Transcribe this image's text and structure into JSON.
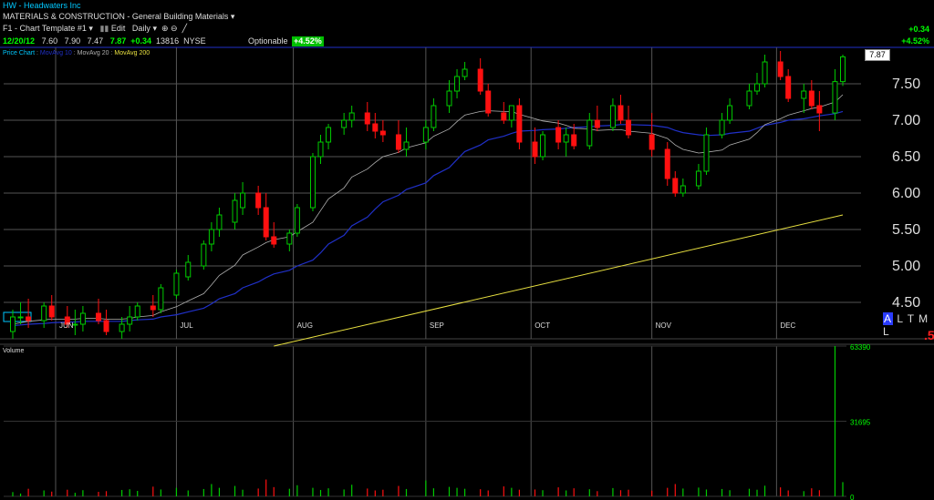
{
  "header": {
    "symbol": "HW",
    "company": "Headwaters Inc",
    "sector": "MATERIALS & CONSTRUCTION - General Building Materials",
    "template": "F1 - Chart Template #1",
    "edit_label": "Edit",
    "period_label": "Daily",
    "quote": {
      "date": "12/20/12",
      "open": "7.60",
      "high": "7.90",
      "low": "7.47",
      "last": "7.87",
      "change": "+0.34",
      "volume": "13816",
      "exchange": "NYSE"
    },
    "optionable_label": "Optionable",
    "change_pct": "+4.52%",
    "right_change": "+0.34",
    "right_change_pct": "+4.52%"
  },
  "legend": {
    "price_chart": "Price Chart",
    "ma10": "MovAvg 10",
    "ma20": "MovAvg 20",
    "ma200": "MovAvg 200"
  },
  "volume_label": "Volume",
  "altml": {
    "a": "A",
    "rest": "L T M L"
  },
  "footer_mark": ".5",
  "colors": {
    "up": "#00cc00",
    "down": "#ff1010",
    "ma20": "#b0b0b0",
    "ma10": "#2030c8",
    "ma200": "#e8e040",
    "grid": "#555555",
    "text": "#dddddd"
  },
  "chart_data": {
    "type": "candlestick",
    "x": [
      "2012-05-21",
      "2012-05-23",
      "2012-05-25",
      "2012-05-29",
      "2012-05-31",
      "2012-06-04",
      "2012-06-06",
      "2012-06-08",
      "2012-06-12",
      "2012-06-14",
      "2012-06-18",
      "2012-06-20",
      "2012-06-22",
      "2012-06-26",
      "2012-06-28",
      "2012-07-02",
      "2012-07-05",
      "2012-07-09",
      "2012-07-11",
      "2012-07-13",
      "2012-07-17",
      "2012-07-19",
      "2012-07-23",
      "2012-07-25",
      "2012-07-27",
      "2012-07-31",
      "2012-08-02",
      "2012-08-06",
      "2012-08-08",
      "2012-08-10",
      "2012-08-14",
      "2012-08-16",
      "2012-08-20",
      "2012-08-22",
      "2012-08-24",
      "2012-08-28",
      "2012-08-30",
      "2012-09-04",
      "2012-09-06",
      "2012-09-10",
      "2012-09-12",
      "2012-09-14",
      "2012-09-18",
      "2012-09-20",
      "2012-09-24",
      "2012-09-26",
      "2012-09-28",
      "2012-10-02",
      "2012-10-04",
      "2012-10-08",
      "2012-10-10",
      "2012-10-12",
      "2012-10-16",
      "2012-10-18",
      "2012-10-22",
      "2012-10-24",
      "2012-10-26",
      "2012-11-01",
      "2012-11-05",
      "2012-11-07",
      "2012-11-09",
      "2012-11-13",
      "2012-11-15",
      "2012-11-19",
      "2012-11-21",
      "2012-11-26",
      "2012-11-28",
      "2012-11-30",
      "2012-12-04",
      "2012-12-06",
      "2012-12-10",
      "2012-12-12",
      "2012-12-14",
      "2012-12-18",
      "2012-12-20"
    ],
    "open": [
      4.1,
      4.3,
      4.3,
      4.25,
      4.45,
      4.3,
      4.2,
      4.2,
      4.35,
      4.25,
      4.1,
      4.2,
      4.3,
      4.45,
      4.4,
      4.6,
      4.85,
      5.0,
      5.3,
      5.5,
      5.6,
      5.8,
      6.0,
      5.8,
      5.4,
      5.3,
      5.45,
      5.8,
      6.5,
      6.7,
      6.9,
      7.0,
      7.1,
      6.95,
      6.85,
      6.8,
      6.6,
      6.7,
      6.9,
      7.2,
      7.4,
      7.6,
      7.7,
      7.4,
      7.1,
      7.0,
      7.2,
      6.7,
      6.5,
      6.9,
      6.7,
      6.8,
      6.65,
      7.0,
      6.9,
      7.2,
      7.0,
      6.8,
      6.6,
      6.2,
      6.0,
      6.1,
      6.3,
      6.8,
      7.0,
      7.2,
      7.4,
      7.5,
      7.8,
      7.6,
      7.3,
      7.4,
      7.2,
      7.1,
      7.53
    ],
    "high": [
      4.4,
      4.5,
      4.55,
      4.5,
      4.6,
      4.45,
      4.4,
      4.45,
      4.55,
      4.4,
      4.3,
      4.45,
      4.5,
      4.6,
      4.75,
      4.95,
      5.15,
      5.35,
      5.6,
      5.8,
      6.0,
      6.15,
      6.1,
      6.0,
      5.6,
      5.5,
      5.85,
      6.55,
      6.8,
      6.95,
      7.1,
      7.2,
      7.25,
      7.1,
      7.0,
      7.0,
      6.9,
      7.0,
      7.3,
      7.55,
      7.7,
      7.8,
      7.85,
      7.5,
      7.25,
      7.2,
      7.3,
      6.9,
      6.85,
      7.0,
      6.9,
      6.95,
      7.1,
      7.2,
      7.3,
      7.35,
      7.2,
      7.1,
      6.7,
      6.3,
      6.2,
      6.4,
      6.9,
      7.1,
      7.3,
      7.5,
      7.65,
      7.9,
      7.95,
      7.7,
      7.5,
      7.55,
      7.4,
      7.7,
      7.9
    ],
    "low": [
      4.0,
      4.2,
      4.15,
      4.15,
      4.25,
      4.15,
      4.05,
      4.1,
      4.2,
      4.05,
      4.0,
      4.1,
      4.25,
      4.3,
      4.35,
      4.55,
      4.8,
      4.95,
      5.2,
      5.4,
      5.5,
      5.7,
      5.7,
      5.35,
      5.25,
      5.2,
      5.4,
      5.75,
      6.4,
      6.6,
      6.8,
      6.9,
      6.85,
      6.75,
      6.7,
      6.55,
      6.5,
      6.6,
      6.85,
      7.1,
      7.3,
      7.55,
      7.35,
      7.05,
      6.95,
      6.9,
      6.6,
      6.4,
      6.45,
      6.6,
      6.5,
      6.6,
      6.6,
      6.85,
      6.85,
      6.95,
      6.75,
      6.5,
      6.1,
      5.95,
      5.95,
      6.05,
      6.25,
      6.75,
      6.95,
      7.15,
      7.35,
      7.45,
      7.55,
      7.25,
      7.1,
      7.15,
      6.85,
      7.0,
      7.47
    ],
    "close": [
      4.3,
      4.3,
      4.25,
      4.45,
      4.3,
      4.2,
      4.2,
      4.35,
      4.25,
      4.1,
      4.2,
      4.3,
      4.45,
      4.4,
      4.7,
      4.9,
      5.05,
      5.3,
      5.5,
      5.7,
      5.9,
      6.0,
      5.8,
      5.4,
      5.3,
      5.45,
      5.8,
      6.5,
      6.7,
      6.9,
      7.0,
      7.1,
      6.95,
      6.85,
      6.8,
      6.6,
      6.7,
      6.9,
      7.2,
      7.4,
      7.6,
      7.7,
      7.4,
      7.1,
      7.0,
      7.2,
      6.7,
      6.5,
      6.8,
      6.7,
      6.8,
      6.65,
      7.0,
      6.9,
      7.2,
      7.0,
      6.8,
      6.6,
      6.2,
      6.0,
      6.1,
      6.3,
      6.8,
      7.0,
      7.2,
      7.4,
      7.5,
      7.8,
      7.6,
      7.3,
      7.4,
      7.2,
      7.1,
      7.53,
      7.87
    ],
    "ma20": [
      4.2,
      4.22,
      4.24,
      4.26,
      4.27,
      4.27,
      4.27,
      4.28,
      4.28,
      4.27,
      4.27,
      4.28,
      4.3,
      4.32,
      4.37,
      4.44,
      4.52,
      4.62,
      4.74,
      4.87,
      5.01,
      5.15,
      5.26,
      5.32,
      5.36,
      5.4,
      5.47,
      5.6,
      5.76,
      5.92,
      6.07,
      6.22,
      6.33,
      6.42,
      6.5,
      6.56,
      6.62,
      6.69,
      6.78,
      6.88,
      6.98,
      7.07,
      7.12,
      7.13,
      7.12,
      7.12,
      7.08,
      7.02,
      6.99,
      6.96,
      6.93,
      6.89,
      6.88,
      6.86,
      6.87,
      6.87,
      6.85,
      6.82,
      6.75,
      6.66,
      6.6,
      6.55,
      6.56,
      6.59,
      6.66,
      6.74,
      6.83,
      6.94,
      7.02,
      7.07,
      7.13,
      7.16,
      7.18,
      7.25,
      7.35
    ],
    "ma10": [
      4.18,
      4.19,
      4.2,
      4.21,
      4.22,
      4.23,
      4.23,
      4.24,
      4.24,
      4.24,
      4.24,
      4.25,
      4.26,
      4.27,
      4.3,
      4.33,
      4.37,
      4.42,
      4.48,
      4.55,
      4.62,
      4.7,
      4.78,
      4.84,
      4.89,
      4.94,
      5.0,
      5.08,
      5.18,
      5.3,
      5.42,
      5.55,
      5.67,
      5.78,
      5.88,
      5.97,
      6.05,
      6.14,
      6.24,
      6.35,
      6.46,
      6.57,
      6.66,
      6.73,
      6.78,
      6.82,
      6.85,
      6.86,
      6.87,
      6.88,
      6.89,
      6.9,
      6.91,
      6.92,
      6.93,
      6.94,
      6.94,
      6.93,
      6.9,
      6.86,
      6.83,
      6.8,
      6.79,
      6.8,
      6.82,
      6.85,
      6.89,
      6.93,
      6.97,
      7.0,
      7.02,
      7.04,
      7.06,
      7.09,
      7.12
    ],
    "ma200_start": 3.9,
    "ma200_end": 5.7,
    "volume": [
      1800,
      1200,
      3200,
      2500,
      2000,
      2800,
      1500,
      2600,
      1900,
      2200,
      2700,
      3000,
      2300,
      4100,
      2900,
      3600,
      2500,
      3100,
      5200,
      3600,
      4400,
      2800,
      3300,
      7100,
      3900,
      3200,
      4700,
      3600,
      2700,
      3400,
      2900,
      4900,
      3300,
      2500,
      2800,
      4400,
      3100,
      6700,
      3400,
      4000,
      3600,
      3200,
      3000,
      2500,
      4200,
      3600,
      2800,
      2900,
      2600,
      3800,
      2500,
      3400,
      3000,
      2200,
      3500,
      2600,
      2800,
      2400,
      3600,
      5200,
      3300,
      3700,
      2900,
      3100,
      2600,
      3200,
      2800,
      4500,
      3800,
      2500,
      2200,
      3400,
      2600,
      63390,
      6000
    ],
    "ylim": [
      4.0,
      8.0
    ],
    "yticks": [
      "7.50",
      "7.00",
      "6.50",
      "6.00",
      "5.50",
      "5.00",
      "4.50"
    ],
    "month_labels": [
      "JUN",
      "JUL",
      "AUG",
      "SEP",
      "OCT",
      "NOV",
      "DEC"
    ],
    "volume_ticks": [
      "63390",
      "31695",
      "0"
    ],
    "last_price_label": "7.87"
  }
}
